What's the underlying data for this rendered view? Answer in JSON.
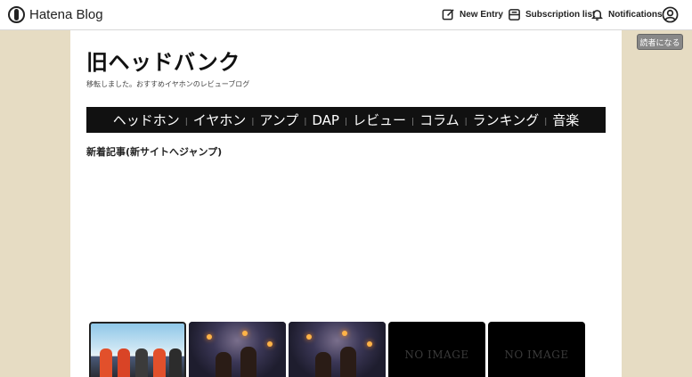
{
  "topbar": {
    "brand": "Hatena Blog",
    "new_entry": "New Entry",
    "subscription_list": "Subscription list",
    "notifications": "Notifications"
  },
  "subscribe_button": "読者になる",
  "blog": {
    "title": "旧ヘッドバンク",
    "description": "移転しました。おすすめイヤホンのレビューブログ"
  },
  "global_nav": {
    "items": [
      "ヘッドホン",
      "イヤホン",
      "アンプ",
      "DAP",
      "レビュー",
      "コラム",
      "ランキング",
      "音楽"
    ],
    "separator": "|"
  },
  "section": {
    "title": "新着記事(新サイトへジャンプ)"
  },
  "thumbnails": [
    {
      "type": "image",
      "icon": "anime-group-image"
    },
    {
      "type": "image",
      "icon": "anime-night-scene-image"
    },
    {
      "type": "image",
      "icon": "anime-night-scene-image"
    },
    {
      "type": "placeholder",
      "label": "NO IMAGE"
    },
    {
      "type": "placeholder",
      "label": "NO IMAGE"
    }
  ],
  "colors": {
    "background": "#e6dcc3",
    "nav_bar": "#111111",
    "subscribe_button": "#888888"
  }
}
